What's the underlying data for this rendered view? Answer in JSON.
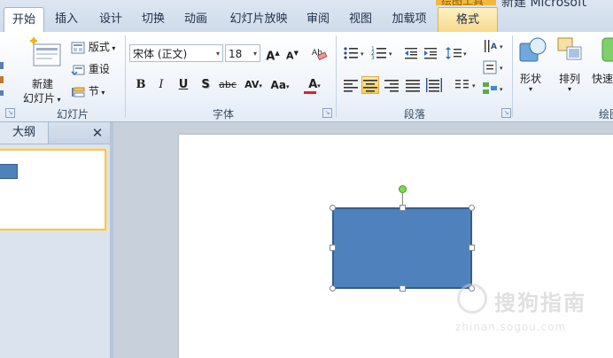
{
  "title_bar": {
    "context_group": "绘图工具",
    "document_title": "新建 Microsoft"
  },
  "tabs": [
    {
      "label": "开始"
    },
    {
      "label": "插入"
    },
    {
      "label": "设计"
    },
    {
      "label": "切换"
    },
    {
      "label": "动画"
    },
    {
      "label": "幻灯片放映"
    },
    {
      "label": "审阅"
    },
    {
      "label": "视图"
    },
    {
      "label": "加载项"
    },
    {
      "label": "格式"
    }
  ],
  "ribbon": {
    "slides_group": {
      "label": "幻灯片",
      "new_slide_line1": "新建",
      "new_slide_line2": "幻灯片",
      "layout": "版式",
      "reset": "重设",
      "section": "节"
    },
    "font_group": {
      "label": "字体",
      "font_name": "宋体 (正文)",
      "font_size": "18",
      "bold": "B",
      "italic": "I",
      "underline": "U",
      "shadow": "S",
      "strikethrough": "abc",
      "spacing": "AV",
      "change_case": "Aa",
      "grow_font": "A",
      "shrink_font": "A",
      "font_color": "A"
    },
    "paragraph_group": {
      "label": "段落"
    },
    "drawing_group": {
      "label": "绘图",
      "shapes": "形状",
      "arrange": "排列",
      "quick_styles": "快速"
    }
  },
  "left_panel": {
    "tab_label": "大纲",
    "close": "✕"
  },
  "watermark": {
    "text": "搜狗指南",
    "url": "zhinan.sogou.com"
  },
  "colors": {
    "shape_fill": "#4f81bd",
    "shape_border": "#385d8a",
    "selected_tab_accent": "#f3b93d"
  }
}
